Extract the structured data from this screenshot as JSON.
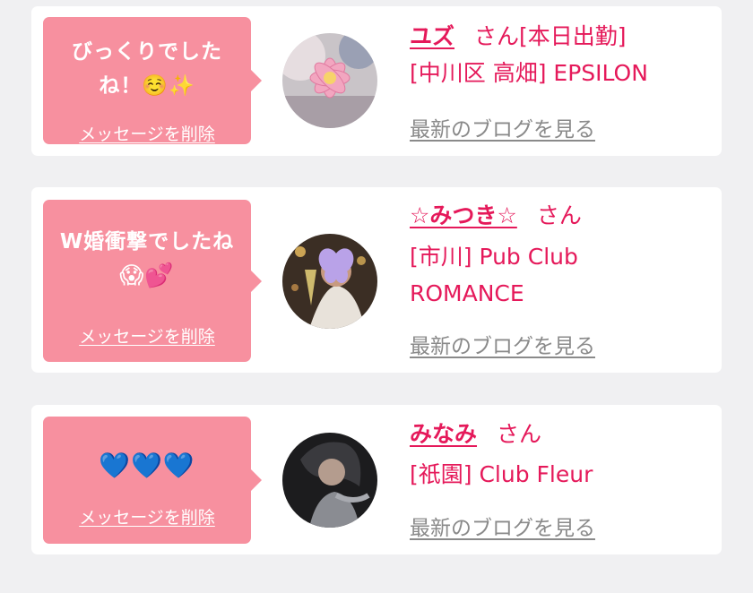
{
  "colors": {
    "background": "#f0f0f2",
    "card": "#ffffff",
    "bubble": "#f7909f",
    "accent": "#e5195a",
    "muted_link": "#8a8a8a"
  },
  "labels": {
    "delete": "メッセージを削除",
    "blog": "最新のブログを見る",
    "honorific": "さん"
  },
  "cards": [
    {
      "message_line1": "びっくりでした",
      "message_line2": "ね！☺️✨",
      "name": "ユズ",
      "status": "[本日出勤]",
      "shop_line1": "[中川区 高畑] EPSILON",
      "shop_line2": ""
    },
    {
      "message_line1": "W婚衝撃でしたね",
      "message_line2": "😱💕",
      "name": "☆みつき☆",
      "status": "",
      "shop_line1": "[市川] Pub Club",
      "shop_line2": "ROMANCE"
    },
    {
      "message_line1": "💙💙💙",
      "message_line2": "",
      "name": "みなみ",
      "status": "",
      "shop_line1": "[祇園] Club Fleur",
      "shop_line2": ""
    }
  ]
}
